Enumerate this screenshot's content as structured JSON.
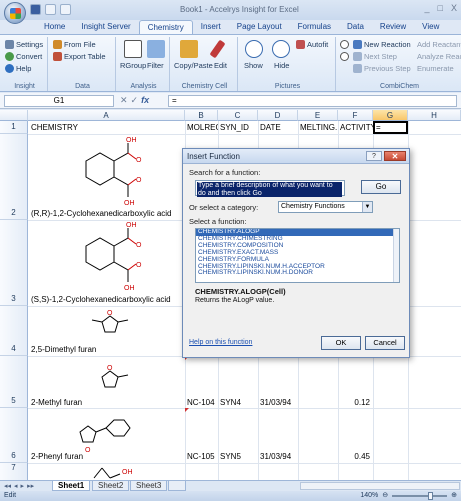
{
  "window": {
    "title": "Book1 - Accelrys Insight for Excel",
    "controls": [
      "_",
      "□",
      "X"
    ]
  },
  "ribbon_tabs": [
    {
      "label": "Home",
      "active": false
    },
    {
      "label": "Insight Server",
      "active": false
    },
    {
      "label": "Chemistry",
      "active": true
    },
    {
      "label": "Insert",
      "active": false
    },
    {
      "label": "Page Layout",
      "active": false
    },
    {
      "label": "Formulas",
      "active": false
    },
    {
      "label": "Data",
      "active": false
    },
    {
      "label": "Review",
      "active": false
    },
    {
      "label": "View",
      "active": false
    }
  ],
  "ribbon": {
    "insight": {
      "label": "Insight",
      "settings": "Settings",
      "convert": "Convert",
      "help": "Help"
    },
    "data": {
      "label": "Data",
      "from_file": "From File",
      "export_table": "Export Table"
    },
    "analysis": {
      "label": "Analysis",
      "rgroup": "RGroup",
      "filter": "Filter"
    },
    "chem_cell": {
      "label": "Chemistry Cell",
      "copy_paste": "Copy/Paste",
      "edit": "Edit"
    },
    "pictures": {
      "label": "Pictures",
      "show": "Show",
      "hide": "Hide",
      "autofit": "Autofit"
    },
    "combichem": {
      "label": "CombiChem",
      "new_reaction": "New Reaction",
      "add_reactant": "Add Reactant",
      "next_step": "Next Step",
      "analyze_reaction": "Analyze Reac",
      "previous_step": "Previous Step",
      "enumerate": "Enumerate"
    }
  },
  "formula_bar": {
    "name_box": "G1",
    "formula": "="
  },
  "columns": [
    "A",
    "B",
    "C",
    "D",
    "E",
    "F",
    "G",
    "H"
  ],
  "rows": [
    {
      "num": "1",
      "A": "CHEMISTRY",
      "B": "MOLREGN",
      "C": "SYN_ID",
      "D": "DATE",
      "E": "MELTING.I",
      "F": "ACTIVITY",
      "G": "="
    },
    {
      "num": "2",
      "A": "(R,R)-1,2-Cyclohexanedicarboxylic acid"
    },
    {
      "num": "3",
      "A": "(S,S)-1,2-Cyclohexanedicarboxylic acid"
    },
    {
      "num": "4",
      "A": "2,5-Dimethyl furan"
    },
    {
      "num": "5",
      "A": "2-Methyl furan",
      "B": "NC-104",
      "C": "SYN4",
      "D": "31/03/94",
      "F": "0.12"
    },
    {
      "num": "6",
      "A": "2-Phenyl furan",
      "B": "NC-105",
      "C": "SYN5",
      "D": "31/03/94",
      "F": "0.45"
    },
    {
      "num": "7"
    }
  ],
  "molecule_labels": {
    "oh": "OH",
    "o": "O"
  },
  "dialog": {
    "title": "Insert Function",
    "search_label": "Search for a function:",
    "search_value": "Type a brief description of what you want to do and then click Go",
    "go": "Go",
    "category_label": "Or select a category:",
    "category_value": "Chemistry Functions",
    "select_label": "Select a function:",
    "functions": [
      "CHEMISTRY.ALOGP",
      "CHEMISTRY.CHIMESTRING",
      "CHEMISTRY.COMPOSITION",
      "CHEMISTRY.EXACT.MASS",
      "CHEMISTRY.FORMULA",
      "CHEMISTRY.LIPINSKI.NUM.H.ACCEPTOR",
      "CHEMISTRY.LIPINSKI.NUM.H.DONOR"
    ],
    "selected_signature": "CHEMISTRY.ALOGP(Cell)",
    "description": "Returns the ALogP value.",
    "help_link": "Help on this function",
    "ok": "OK",
    "cancel": "Cancel"
  },
  "sheets": [
    {
      "label": "Sheet1",
      "active": true
    },
    {
      "label": "Sheet2",
      "active": false
    },
    {
      "label": "Sheet3",
      "active": false
    }
  ],
  "status": {
    "mode": "Edit",
    "zoom": "140%"
  }
}
